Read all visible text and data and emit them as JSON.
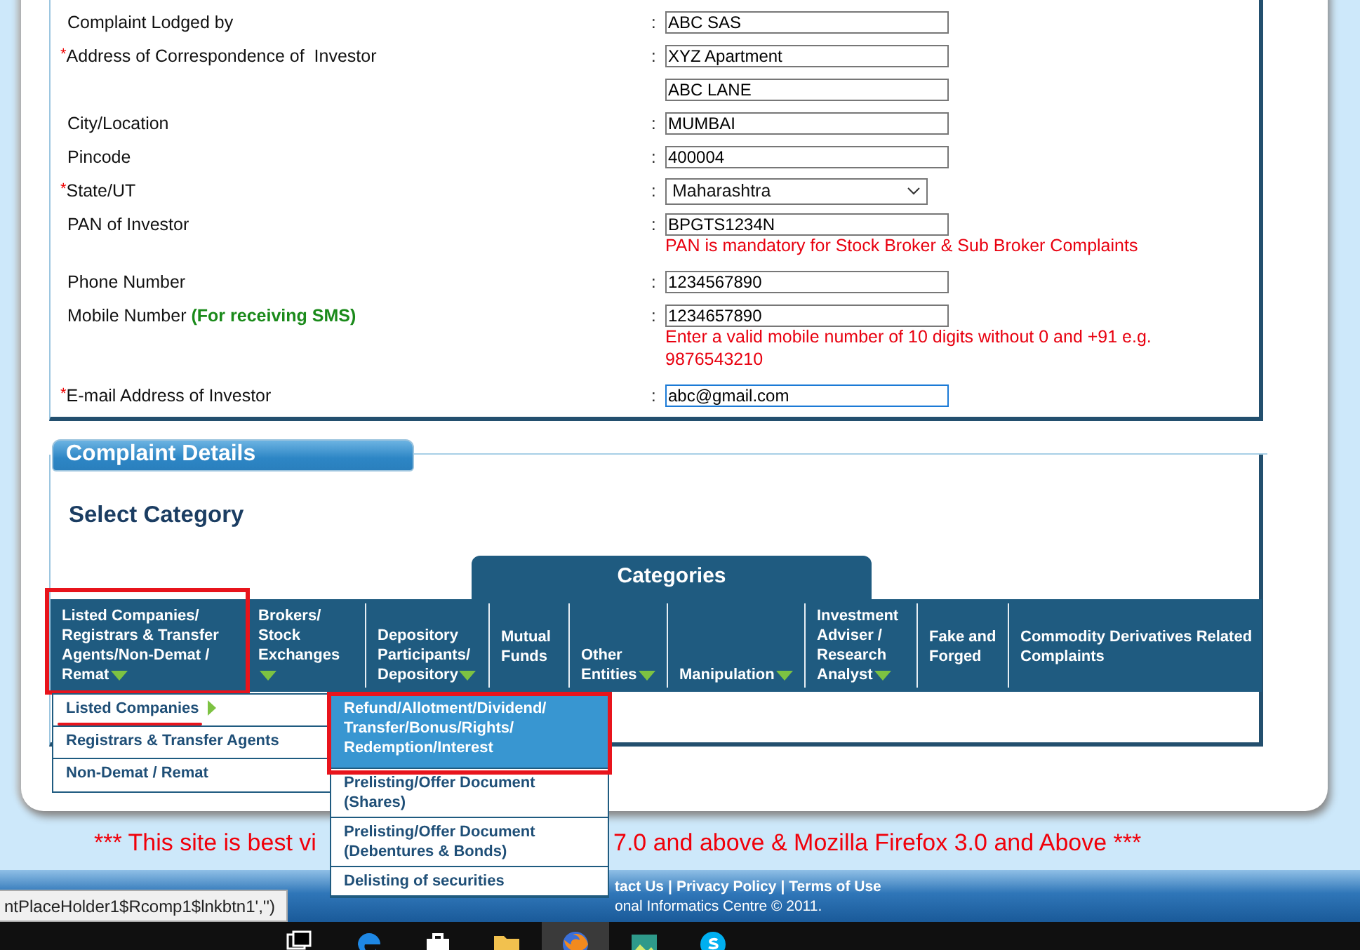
{
  "form": {
    "rows": [
      {
        "label": "Complaint Lodged by",
        "colon": ":",
        "fields": [
          {
            "kind": "text",
            "value": "ABC SAS",
            "focused": false
          }
        ]
      },
      {
        "mark": "*",
        "label": "Address of Correspondence of  Investor",
        "colon": ":",
        "fields": [
          {
            "kind": "text",
            "value": "XYZ Apartment",
            "focused": false
          },
          {
            "kind": "text",
            "value": "ABC LANE",
            "focused": false
          }
        ]
      },
      {
        "label": "City/Location",
        "colon": ":",
        "fields": [
          {
            "kind": "text",
            "value": "MUMBAI",
            "focused": false
          }
        ]
      },
      {
        "label": "Pincode",
        "colon": ":",
        "fields": [
          {
            "kind": "text",
            "value": "400004",
            "focused": false
          }
        ]
      },
      {
        "mark": "*",
        "label": "State/UT",
        "colon": ":",
        "fields": [
          {
            "kind": "select",
            "value": "Maharashtra",
            "focused": false
          }
        ]
      },
      {
        "label": "PAN of Investor",
        "colon": ":",
        "fields": [
          {
            "kind": "text",
            "value": "BPGTS1234N",
            "focused": false
          }
        ],
        "hint": "PAN is mandatory for Stock Broker & Sub Broker Complaints"
      },
      {
        "label": "Phone Number",
        "colon": ":",
        "fields": [
          {
            "kind": "text",
            "value": "1234567890",
            "focused": false
          }
        ]
      },
      {
        "label": "Mobile Number",
        "label_note": "(For receiving SMS)",
        "colon": ":",
        "fields": [
          {
            "kind": "text",
            "value": "1234657890",
            "focused": false
          }
        ],
        "hint": "Enter a valid mobile number of 10 digits without 0 and +91 e.g. 9876543210"
      },
      {
        "mark": "*",
        "label": "E-mail Address of Investor",
        "colon": ":",
        "fields": [
          {
            "kind": "text",
            "value": "abc@gmail.com",
            "focused": true
          }
        ]
      }
    ]
  },
  "section": {
    "title": "Complaint Details",
    "heading": "Select Category",
    "categories_title": "Categories",
    "categories": [
      {
        "label": "Listed Companies/Registrars & Transfer Agents/Non-Demat / Remat",
        "has_menu": true,
        "highlighted": true
      },
      {
        "label": "Brokers/Stock Exchanges",
        "has_menu": true,
        "highlighted": false
      },
      {
        "label": "Depository Participants/Depository",
        "has_menu": true,
        "highlighted": false
      },
      {
        "label": "Mutual Funds",
        "has_menu": false,
        "highlighted": false
      },
      {
        "label": "Other Entities",
        "has_menu": true,
        "highlighted": false
      },
      {
        "label": "Manipulation",
        "has_menu": true,
        "highlighted": false
      },
      {
        "label": "Investment Adviser / Research Analyst",
        "has_menu": true,
        "highlighted": false
      },
      {
        "label": "Fake and Forged",
        "has_menu": false,
        "highlighted": false
      },
      {
        "label": "Commodity Derivatives Related Complaints",
        "has_menu": false,
        "highlighted": false
      }
    ],
    "menu": [
      {
        "label": "Listed Companies",
        "has_submenu": true,
        "underlined": true
      },
      {
        "label": "Registrars & Transfer Agents",
        "has_submenu": false,
        "underlined": false
      },
      {
        "label": "Non-Demat / Remat",
        "has_submenu": false,
        "underlined": false
      }
    ],
    "submenu": [
      {
        "label": "Refund/Allotment/Dividend/Transfer/Bonus/Rights/Redemption/Interest",
        "hovered": true,
        "highlighted": true
      },
      {
        "label": "Prelisting/Offer Document (Shares)",
        "hovered": false,
        "highlighted": false
      },
      {
        "label": "Prelisting/Offer Document (Debentures & Bonds)",
        "hovered": false,
        "highlighted": false
      },
      {
        "label": "Delisting of securities",
        "hovered": false,
        "highlighted": false
      }
    ]
  },
  "notice_parts": [
    "*** This site is best vi",
    "7.0 and above & Mozilla Firefox 3.0 and Above ***"
  ],
  "footer": {
    "links": [
      "tact Us",
      "Privacy Policy",
      "Terms of Use"
    ],
    "separator": "|",
    "copyright": "onal Informatics Centre © 2011."
  },
  "status_tooltip": "ntPlaceHolder1$Rcomp1$lnkbtn1','')",
  "taskbar": {
    "apps": [
      {
        "kind": "taskview",
        "active": false
      },
      {
        "kind": "edge",
        "active": false
      },
      {
        "kind": "store",
        "active": false
      },
      {
        "kind": "folder",
        "active": false
      },
      {
        "kind": "firefox",
        "active": true
      },
      {
        "kind": "photos",
        "active": false
      },
      {
        "kind": "skype",
        "active": false
      }
    ]
  }
}
